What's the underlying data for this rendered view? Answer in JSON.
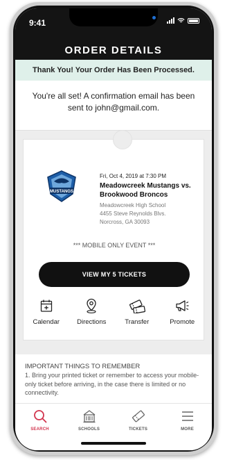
{
  "status": {
    "time": "9:41"
  },
  "header": {
    "title": "ORDER DETAILS"
  },
  "banner": {
    "text": "Thank You! Your Order Has Been Processed."
  },
  "confirmation": {
    "text": "You're all set! A confirmation email has been sent to john@gmail.com."
  },
  "event": {
    "logo_text": "MUSTANGS",
    "date": "Fri, Oct 4, 2019 at 7:30 PM",
    "title_line1": "Meadowcreek Mustangs vs.",
    "title_line2": "Brookwood Broncos",
    "venue_name": "Meadowcreek High School",
    "address_line1": "4455 Steve Reynolds Blvs.",
    "address_line2": "Norcross, GA 30093",
    "note": "*** MOBILE ONLY EVENT ***"
  },
  "view_button": {
    "label": "VIEW MY 5 TICKETS"
  },
  "actions": [
    {
      "label": "Calendar",
      "icon": "calendar-icon"
    },
    {
      "label": "Directions",
      "icon": "location-pin-icon"
    },
    {
      "label": "Transfer",
      "icon": "ticket-transfer-icon"
    },
    {
      "label": "Promote",
      "icon": "megaphone-icon"
    }
  ],
  "important": {
    "heading": "IMPORTANT THINGS TO REMEMBER",
    "item1": "1. Bring your printed ticket or remember to access your mobile-only ticket before arriving, in the case there is limited or no connectivity."
  },
  "tabs": [
    {
      "label": "SEARCH",
      "icon": "search-icon",
      "active": true
    },
    {
      "label": "SCHOOLS",
      "icon": "school-icon",
      "active": false
    },
    {
      "label": "TICKETS",
      "icon": "ticket-icon",
      "active": false
    },
    {
      "label": "MORE",
      "icon": "menu-icon",
      "active": false
    }
  ],
  "colors": {
    "accent": "#d2344d",
    "banner_bg": "#dff0ea",
    "header_bg": "#141414"
  }
}
